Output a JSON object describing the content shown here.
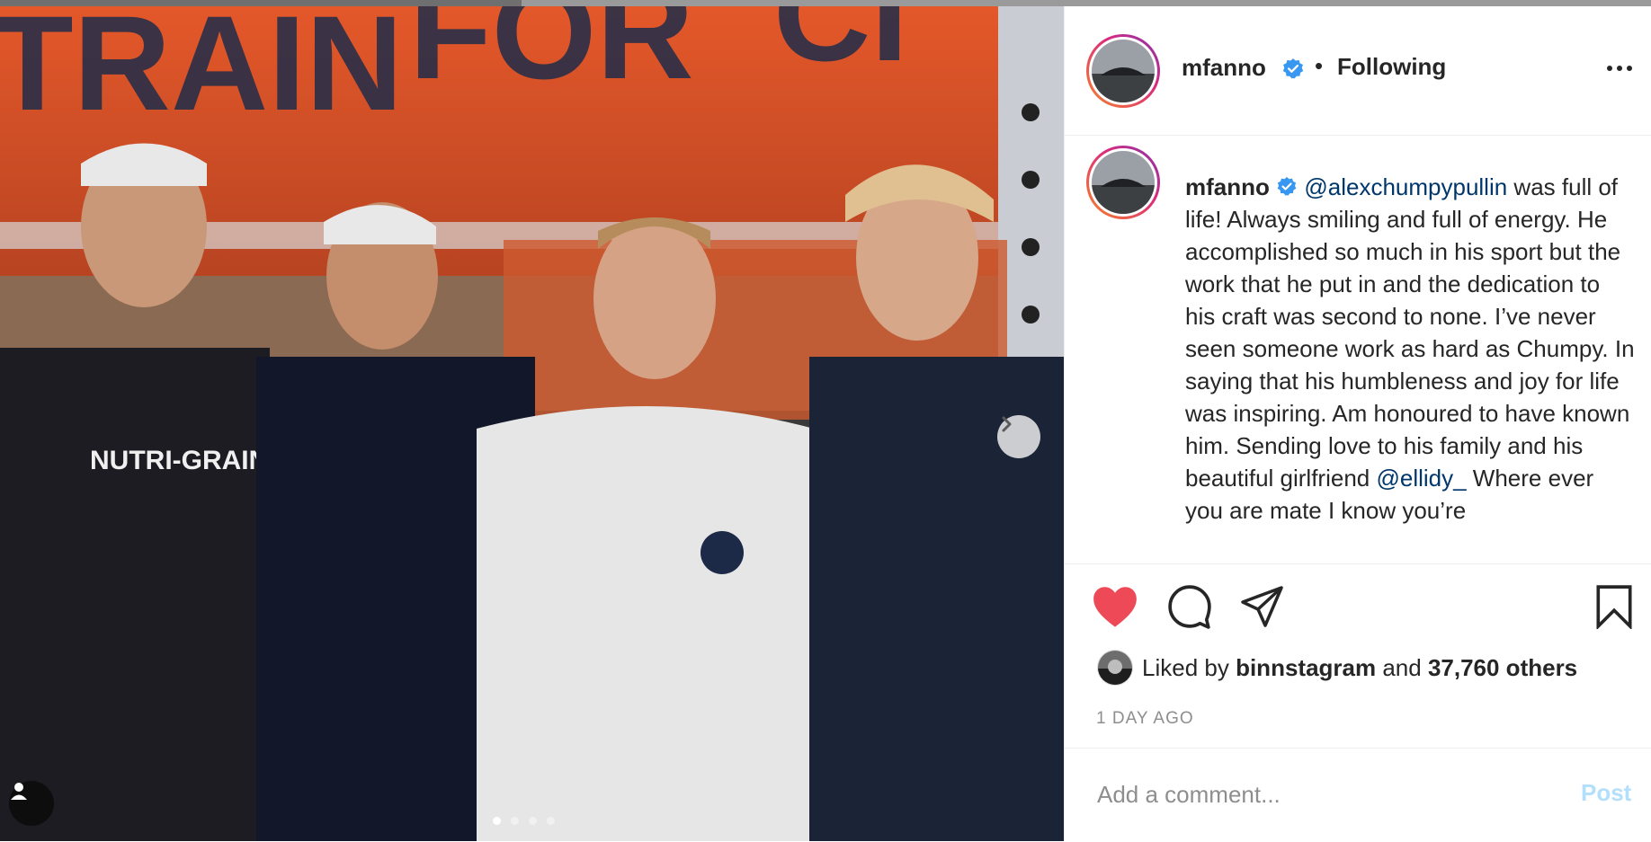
{
  "post": {
    "photo_alt": "",
    "carousel": {
      "slide_count": 4,
      "active_index": 0
    }
  },
  "header": {
    "username": "mfanno",
    "separator": "•",
    "follow_status": "Following"
  },
  "caption": {
    "username": "mfanno",
    "mention_1": "@alexchumpypullin",
    "text_1": " was full of life! Always smiling and full of energy. He accomplished so much in his sport but the work that he put in and the dedication to his craft was second to none. I’ve never seen someone work as hard as Chumpy. In saying that his humbleness and joy for life was inspiring. Am honoured to have known him. Sending love to his family and his beautiful girlfriend ",
    "mention_2": "@ellidy_",
    "text_2": " Where ever you are mate I know you’re"
  },
  "likes": {
    "prefix": "Liked by ",
    "user": "binnstagram",
    "conjunction": " and ",
    "count": "37,760 others"
  },
  "timestamp": "1 DAY AGO",
  "comment": {
    "placeholder": "Add a comment...",
    "post_label": "Post"
  },
  "colors": {
    "like_red": "#ed4956",
    "verified_blue": "#3897f0",
    "mention_blue": "#00376b",
    "post_disabled": "#b2dffc",
    "photo_orange": "#e4582a"
  },
  "icons": [
    "heart-icon",
    "comment-icon",
    "share-icon",
    "bookmark-icon",
    "chevron-right-icon",
    "user-tag-icon",
    "more-icon",
    "verified-icon"
  ]
}
